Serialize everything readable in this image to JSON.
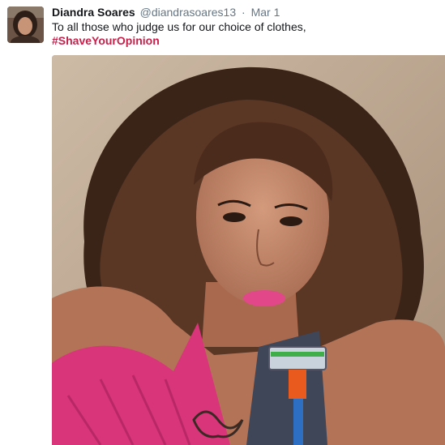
{
  "tweet": {
    "author_name": "Diandra Soares",
    "author_handle": "@diandrasoares13",
    "separator": "·",
    "date": "Mar 1",
    "text": "To all those who judge us for our choice of clothes,",
    "hashtag": "#ShaveYourOpinion"
  },
  "colors": {
    "hashtag": "#c6214b",
    "name": "#14171a",
    "meta": "#657786"
  }
}
